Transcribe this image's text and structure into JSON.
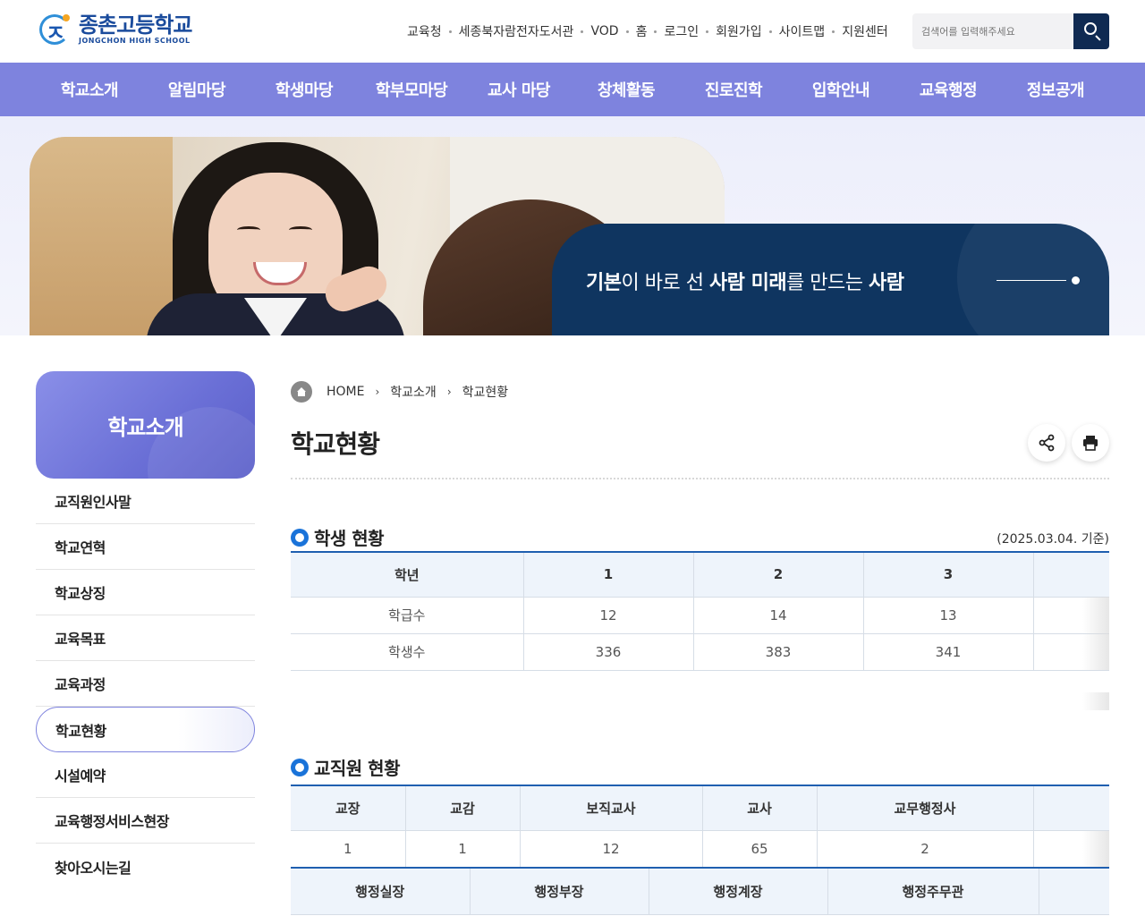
{
  "logo": {
    "ko": "종촌고등학교",
    "en": "JONGCHON HIGH SCHOOL"
  },
  "util": [
    "교육청",
    "세종북자람전자도서관",
    "VOD",
    "홈",
    "로그인",
    "회원가입",
    "사이트맵",
    "지원센터"
  ],
  "search": {
    "placeholder": "검색어를 입력해주세요"
  },
  "gnb": [
    "학교소개",
    "알림마당",
    "학생마당",
    "학부모마당",
    "교사 마당",
    "창체활동",
    "진로진학",
    "입학안내",
    "교육행정",
    "정보공개"
  ],
  "slogan": {
    "b1": "기본",
    "t1": "이 바로 선 ",
    "b2": "사람 미래",
    "t2": "를 만드는 ",
    "b3": "사람"
  },
  "lnb": {
    "title": "학교소개",
    "items": [
      "교직원인사말",
      "학교연혁",
      "학교상징",
      "교육목표",
      "교육과정",
      "학교현황",
      "시설예약",
      "교육행정서비스현장",
      "찾아오시는길"
    ]
  },
  "breadcrumb": {
    "home": "HOME",
    "level1": "학교소개",
    "level2": "학교현황"
  },
  "page_title": "학교현황",
  "students": {
    "title": "학생 현황",
    "note": "(2025.03.04. 기준)",
    "headers": [
      "학년",
      "1",
      "2",
      "3"
    ],
    "rows": [
      [
        "학급수",
        "12",
        "14",
        "13"
      ],
      [
        "학생수",
        "336",
        "383",
        "341"
      ]
    ]
  },
  "staff": {
    "title": "교직원 현황",
    "headers1": [
      "교장",
      "교감",
      "보직교사",
      "교사",
      "교무행정사"
    ],
    "values1": [
      "1",
      "1",
      "12",
      "65",
      "2"
    ],
    "headers2": [
      "행정실장",
      "행정부장",
      "행정계장",
      "행정주무관"
    ]
  }
}
